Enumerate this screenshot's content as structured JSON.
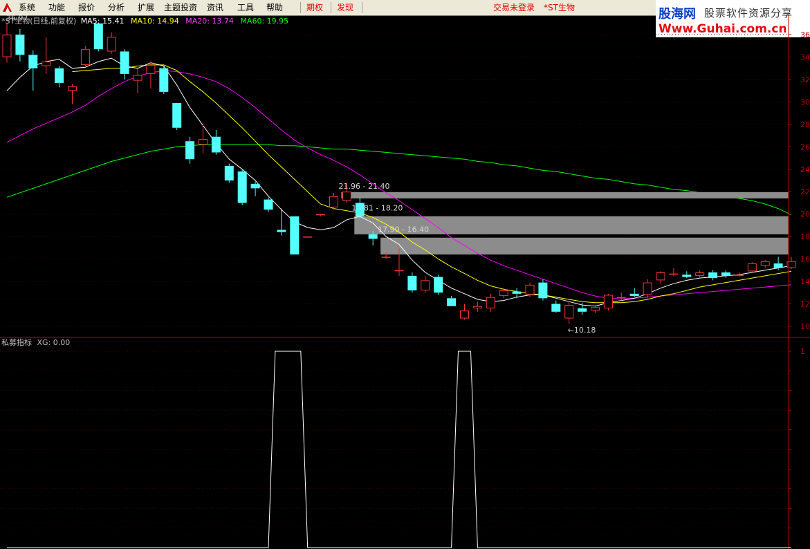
{
  "menu": {
    "items": [
      "系统",
      "功能",
      "报价",
      "分析",
      "扩展",
      "主题投资",
      "资讯",
      "工具",
      "帮助"
    ],
    "red_items": [
      "期权",
      "发现"
    ],
    "status": "交易未登录",
    "stock": "*ST生物"
  },
  "brand": {
    "name": "股海网",
    "slogan": "股票软件资源分享",
    "url": "Www.Guhai.com.cn"
  },
  "colors": {
    "up": "#ff3232",
    "down": "#54ffff",
    "ma5": "#ffffff",
    "ma10": "#ffff00",
    "ma20": "#ff00ff",
    "ma60": "#00ff00",
    "axis": "#c00000",
    "zone": "#8c8c8c"
  },
  "chart_data": {
    "type": "candlestick",
    "title": "*ST生物(日线,前复权)",
    "ma_legend": [
      {
        "name": "MA5",
        "value": "15.41"
      },
      {
        "name": "MA10",
        "value": "14.94"
      },
      {
        "name": "MA20",
        "value": "13.74"
      },
      {
        "name": "MA60",
        "value": "19.95"
      }
    ],
    "ylim": [
      9.5,
      36.5
    ],
    "yticks": [
      10,
      12,
      14,
      16,
      18,
      20,
      22,
      24,
      26,
      28,
      30,
      32,
      34,
      36
    ],
    "candles": [
      [
        34.0,
        36.0,
        37.0,
        33.5
      ],
      [
        36.0,
        34.2,
        36.5,
        33.6
      ],
      [
        34.2,
        33.0,
        34.6,
        31.0
      ],
      [
        33.2,
        33.6,
        35.8,
        32.5
      ],
      [
        33.0,
        31.7,
        33.2,
        31.3
      ],
      [
        31.0,
        31.4,
        31.6,
        29.8
      ],
      [
        33.3,
        34.7,
        35.0,
        33.2
      ],
      [
        37.0,
        34.7,
        37.0,
        34.5
      ],
      [
        34.5,
        35.8,
        36.2,
        34.3
      ],
      [
        34.5,
        32.5,
        34.7,
        32.0
      ],
      [
        31.9,
        32.4,
        33.0,
        30.8
      ],
      [
        32.5,
        33.3,
        33.6,
        31.2
      ],
      [
        33.0,
        30.9,
        33.2,
        30.7
      ],
      [
        29.9,
        27.7,
        29.9,
        27.5
      ],
      [
        26.5,
        24.9,
        26.9,
        24.5
      ],
      [
        26.2,
        26.7,
        28.1,
        25.4
      ],
      [
        26.9,
        25.5,
        27.5,
        25.3
      ],
      [
        24.3,
        23.0,
        24.5,
        22.8
      ],
      [
        23.8,
        21.0,
        24.0,
        20.8
      ],
      [
        22.7,
        22.3,
        22.9,
        21.6
      ],
      [
        21.3,
        20.4,
        21.5,
        20.2
      ],
      [
        18.6,
        18.4,
        20.5,
        18.1
      ],
      [
        19.8,
        16.4,
        19.8,
        16.4
      ],
      [
        18.0,
        18.0,
        18.0,
        18.0
      ],
      [
        19.9,
        20.0,
        20.0,
        19.8
      ],
      [
        20.6,
        21.6,
        21.9,
        20.4
      ],
      [
        21.2,
        22.0,
        22.8,
        21.0
      ],
      [
        21.0,
        19.8,
        21.5,
        19.6
      ],
      [
        18.2,
        17.8,
        18.5,
        17.2
      ],
      [
        16.2,
        16.2,
        16.6,
        16.0
      ],
      [
        15.0,
        15.0,
        17.0,
        14.5
      ],
      [
        14.5,
        13.2,
        14.8,
        13.0
      ],
      [
        13.2,
        14.1,
        14.5,
        13.0
      ],
      [
        14.4,
        13.0,
        14.6,
        12.8
      ],
      [
        12.5,
        11.8,
        12.7,
        11.8
      ],
      [
        10.7,
        11.4,
        12.0,
        10.6
      ],
      [
        11.6,
        11.8,
        12.2,
        11.3
      ],
      [
        11.6,
        12.6,
        12.9,
        11.3
      ],
      [
        12.7,
        13.2,
        13.4,
        12.5
      ],
      [
        13.1,
        12.9,
        13.4,
        12.5
      ],
      [
        12.8,
        13.7,
        13.9,
        12.6
      ],
      [
        13.9,
        12.5,
        14.2,
        12.3
      ],
      [
        12.0,
        11.3,
        12.3,
        11.2
      ],
      [
        10.7,
        11.9,
        12.2,
        10.2
      ],
      [
        11.6,
        11.3,
        12.1,
        11.0
      ],
      [
        11.4,
        11.7,
        11.9,
        11.2
      ],
      [
        11.6,
        12.8,
        12.9,
        11.4
      ],
      [
        12.6,
        12.6,
        13.0,
        12.3
      ],
      [
        12.9,
        12.7,
        13.4,
        12.6
      ],
      [
        12.8,
        13.9,
        14.2,
        12.5
      ],
      [
        14.1,
        14.8,
        14.9,
        13.8
      ],
      [
        14.6,
        14.7,
        15.2,
        14.5
      ],
      [
        14.6,
        14.4,
        14.9,
        14.3
      ],
      [
        14.5,
        14.8,
        15.0,
        14.3
      ],
      [
        14.8,
        14.3,
        15.0,
        14.1
      ],
      [
        14.8,
        14.5,
        15.0,
        14.3
      ],
      [
        14.5,
        14.6,
        14.8,
        14.4
      ],
      [
        14.9,
        15.6,
        15.7,
        14.8
      ],
      [
        15.4,
        15.8,
        15.9,
        15.2
      ],
      [
        15.6,
        15.2,
        16.2,
        15.0
      ],
      [
        15.2,
        15.8,
        16.2,
        15.1
      ]
    ],
    "ma5": [
      31.0,
      32.2,
      33.2,
      33.6,
      33.8,
      33.0,
      33.1,
      33.6,
      33.9,
      33.2,
      33.0,
      33.5,
      33.2,
      31.5,
      29.5,
      27.9,
      26.3,
      24.9,
      24.0,
      23.0,
      21.6,
      20.4,
      19.3,
      18.8,
      18.6,
      18.8,
      19.5,
      19.8,
      19.2,
      18.0,
      17.3,
      15.9,
      14.8,
      14.1,
      13.4,
      12.9,
      12.4,
      12.2,
      12.3,
      12.6,
      12.8,
      12.8,
      12.5,
      12.2,
      11.9,
      11.8,
      12.1,
      12.3,
      12.5,
      12.9,
      13.4,
      13.8,
      14.1,
      14.3,
      14.4,
      14.5,
      14.6,
      14.8,
      15.0,
      15.2,
      15.4
    ],
    "ma10": [
      null,
      null,
      null,
      null,
      null,
      32.7,
      32.8,
      32.9,
      33.0,
      33.0,
      33.2,
      33.3,
      33.3,
      32.8,
      31.8,
      30.9,
      29.9,
      28.8,
      27.7,
      26.5,
      25.3,
      24.2,
      23.1,
      22.0,
      20.9,
      20.5,
      20.3,
      20.1,
      19.7,
      19.1,
      18.4,
      17.5,
      16.8,
      16.0,
      15.3,
      14.7,
      14.1,
      13.6,
      13.3,
      13.1,
      12.9,
      12.8,
      12.6,
      12.4,
      12.2,
      12.1,
      12.1,
      12.1,
      12.2,
      12.4,
      12.7,
      12.9,
      13.2,
      13.5,
      13.7,
      13.9,
      14.1,
      14.3,
      14.5,
      14.7,
      14.9
    ],
    "ma20": [
      26.4,
      27.0,
      27.6,
      28.1,
      28.6,
      29.1,
      29.7,
      30.5,
      31.2,
      31.8,
      32.3,
      32.6,
      32.8,
      32.7,
      32.5,
      32.2,
      31.8,
      31.2,
      30.4,
      29.5,
      28.5,
      27.5,
      26.6,
      25.9,
      25.3,
      24.8,
      24.2,
      23.5,
      22.7,
      21.9,
      21.2,
      20.4,
      19.6,
      18.8,
      17.9,
      17.2,
      16.5,
      15.9,
      15.4,
      15.0,
      14.6,
      14.2,
      13.8,
      13.4,
      13.0,
      12.7,
      12.5,
      12.5,
      12.5,
      12.6,
      12.7,
      12.8,
      12.9,
      13.0,
      13.1,
      13.2,
      13.3,
      13.4,
      13.5,
      13.6,
      13.7
    ],
    "ma60": [
      21.5,
      21.9,
      22.3,
      22.7,
      23.1,
      23.5,
      23.9,
      24.3,
      24.7,
      25.0,
      25.3,
      25.6,
      25.8,
      26.0,
      26.1,
      26.2,
      26.2,
      26.2,
      26.2,
      26.2,
      26.2,
      26.1,
      26.1,
      26.0,
      25.9,
      25.8,
      25.8,
      25.7,
      25.6,
      25.5,
      25.4,
      25.3,
      25.2,
      25.1,
      25.0,
      24.9,
      24.7,
      24.6,
      24.4,
      24.3,
      24.1,
      23.9,
      23.8,
      23.6,
      23.4,
      23.2,
      23.1,
      22.9,
      22.7,
      22.6,
      22.4,
      22.2,
      22.1,
      21.9,
      21.8,
      21.6,
      21.4,
      21.2,
      20.9,
      20.5,
      19.95
    ],
    "zones": [
      {
        "label": "21.96 - 21.40",
        "low": 21.4,
        "high": 21.96,
        "start": 26
      },
      {
        "label": "19.81 - 18.20",
        "low": 18.2,
        "high": 19.81,
        "start": 27
      },
      {
        "label": "17.90 - 16.40",
        "low": 16.4,
        "high": 17.9,
        "start": 29
      }
    ],
    "annotations": [
      {
        "text": "36.97",
        "index": 0,
        "price": 36.97
      },
      {
        "text": "←10.18",
        "index": 43,
        "price": 10.18
      }
    ],
    "indicator": {
      "title": "私募指标",
      "legend": "XG: 0.00",
      "ylim": [
        0,
        1
      ],
      "yticks": [
        "1"
      ],
      "values": [
        0,
        0,
        0,
        0,
        0,
        0,
        0,
        0,
        0,
        0,
        0,
        0,
        0,
        0,
        0,
        0,
        0,
        0,
        0,
        0,
        0,
        1,
        1,
        0,
        0,
        0,
        0,
        0,
        0,
        0,
        0,
        0,
        0,
        0,
        0,
        1,
        0,
        0,
        0,
        0,
        0,
        0,
        0,
        0,
        0,
        0,
        0,
        0,
        0,
        0,
        0,
        0,
        0,
        0,
        0,
        0,
        0,
        0,
        0,
        0,
        0
      ]
    }
  }
}
